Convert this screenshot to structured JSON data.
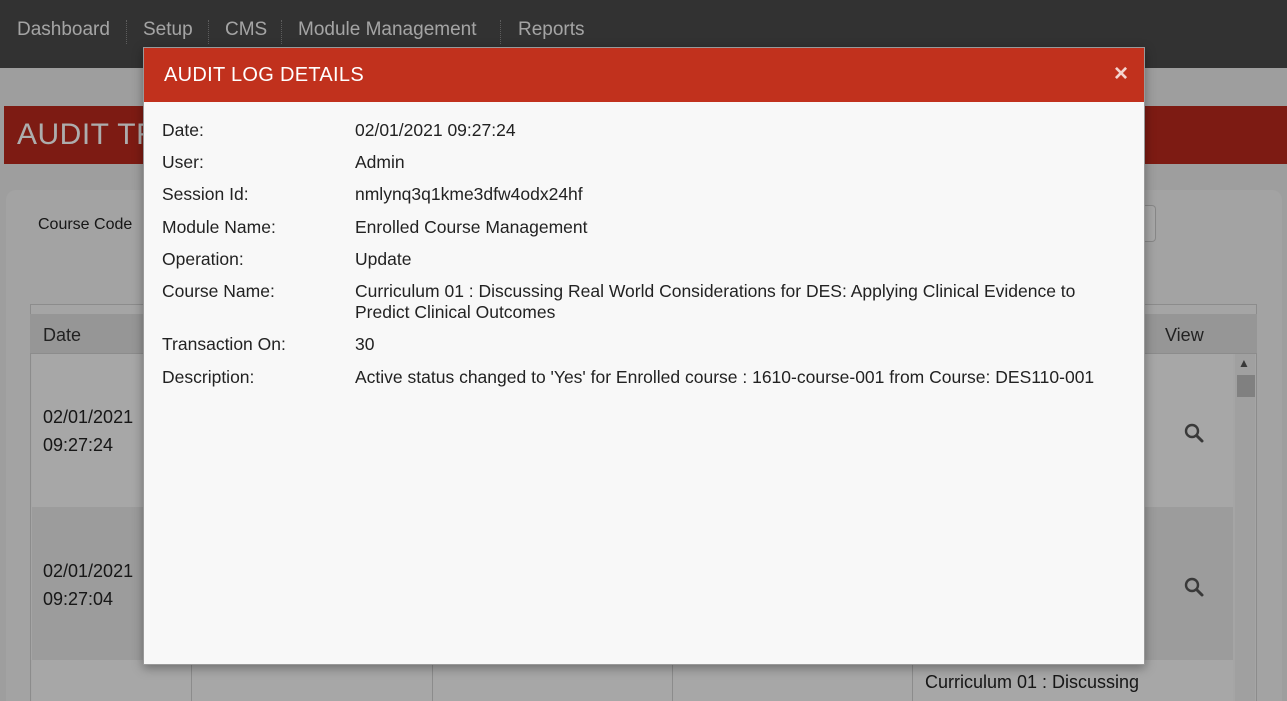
{
  "nav": {
    "items": [
      "Dashboard",
      "Setup",
      "CMS",
      "Module Management",
      "Reports"
    ]
  },
  "page": {
    "title": "AUDIT TR",
    "filter_label": "Course Code"
  },
  "table": {
    "columns": {
      "date": "Date",
      "view": "View"
    },
    "rows": [
      {
        "date_line1": "02/01/2021",
        "date_line2": "09:27:24"
      },
      {
        "date_line1": "02/01/2021",
        "date_line2": "09:27:04"
      }
    ],
    "row3_text": "Curriculum 01 : Discussing"
  },
  "modal": {
    "title": "AUDIT LOG DETAILS",
    "close_symbol": "×",
    "fields": [
      {
        "label": "Date:",
        "value": "02/01/2021 09:27:24"
      },
      {
        "label": "User:",
        "value": "Admin"
      },
      {
        "label": "Session Id:",
        "value": "nmlynq3q1kme3dfw4odx24hf"
      },
      {
        "label": "Module Name:",
        "value": "Enrolled Course Management"
      },
      {
        "label": "Operation:",
        "value": "Update"
      },
      {
        "label": "Course Name:",
        "value": "Curriculum 01 : Discussing Real World Considerations for DES: Applying Clinical Evidence to Predict Clinical Outcomes"
      },
      {
        "label": "Transaction On:",
        "value": "30"
      },
      {
        "label": "Description:",
        "value": "Active status changed to 'Yes' for Enrolled course : 1610-course-001 from Course: DES110-001"
      }
    ]
  },
  "colors": {
    "nav_bg": "#4a4a4a",
    "banner_bg": "#b8291c",
    "modal_header_bg": "#c1311d"
  },
  "icons": {
    "view": "magnifier-icon",
    "close": "close-icon"
  }
}
